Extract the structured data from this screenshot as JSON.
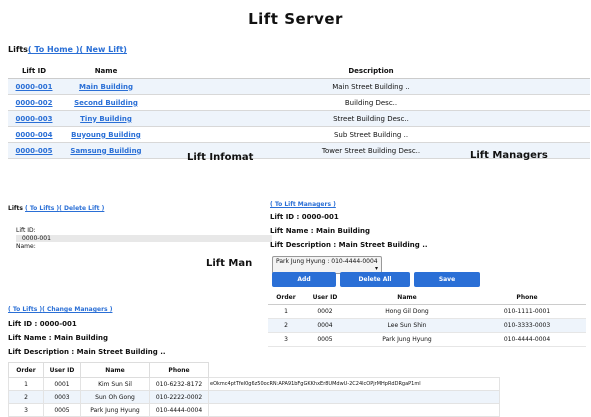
{
  "app_title": "Lift Server",
  "lifts_section": {
    "label": "Lifts",
    "to_home": "( To Home )",
    "new_lift": "( New Lift)",
    "headers": [
      "Lift ID",
      "Name",
      "Description"
    ],
    "rows": [
      {
        "id": "0000-001",
        "name": "Main Building",
        "desc": "Main Street Building .."
      },
      {
        "id": "0000-002",
        "name": "Second Building",
        "desc": "Building Desc.."
      },
      {
        "id": "0000-003",
        "name": "Tiny Building",
        "desc": "Street Building Desc.."
      },
      {
        "id": "0000-004",
        "name": "Buyoung Building",
        "desc": "Sub Street Building .."
      },
      {
        "id": "0000-005",
        "name": "Samsung Building",
        "desc": "Tower Street Building Desc.."
      }
    ]
  },
  "lift_info": {
    "heading": "Lift Infomat",
    "label": "Lifts",
    "to_lifts": "( To Lifts )",
    "delete_lift": "( Delete Lift )",
    "field_label": "Lift ID:",
    "field_value": "0000-001",
    "name_label": "Name:"
  },
  "lift_managers": {
    "heading": "Lift Managers",
    "to_managers": "( To Lift Managers )",
    "lift_id": "Lift ID : 0000-001",
    "lift_name": "Lift Name : Main Building",
    "lift_desc": "Lift Description : Main Street Building ..",
    "select_value": "Park Jung Hyung : 010-4444-0004",
    "buttons": {
      "add": "Add",
      "delete_all": "Delete All",
      "save": "Save"
    },
    "headers": [
      "Order",
      "User ID",
      "Name",
      "Phone"
    ],
    "rows": [
      {
        "order": "1",
        "user": "0002",
        "name": "Hong Gil Dong",
        "phone": "010-1111-0001"
      },
      {
        "order": "2",
        "user": "0004",
        "name": "Lee Sun Shin",
        "phone": "010-3333-0003"
      },
      {
        "order": "3",
        "user": "0005",
        "name": "Park Jung Hyung",
        "phone": "010-4444-0004"
      }
    ]
  },
  "lift_man_partial": {
    "heading": "Lift Man"
  },
  "change_managers": {
    "to_lifts": "( To Lifts )",
    "change_managers": "( Change Managers )",
    "lift_id": "Lift ID : 0000-001",
    "lift_name": "Lift Name : Main Building",
    "lift_desc": "Lift Description : Main Street Building ..",
    "headers": [
      "Order",
      "User ID",
      "Name",
      "Phone"
    ],
    "rows": [
      {
        "order": "1",
        "user": "0001",
        "name": "Kim Sun Sil",
        "phone": "010-6232-8172",
        "token": "eOkmc4ptTfel0g6z50ocRN:APA91bFgGKKhxEr8UMdwU-2C24lcOPjrMHpRdDRgaP1ml"
      },
      {
        "order": "2",
        "user": "0003",
        "name": "Sun Oh Gong",
        "phone": "010-2222-0002",
        "token": ""
      },
      {
        "order": "3",
        "user": "0005",
        "name": "Park Jung Hyung",
        "phone": "010-4444-0004",
        "token": ""
      }
    ]
  }
}
